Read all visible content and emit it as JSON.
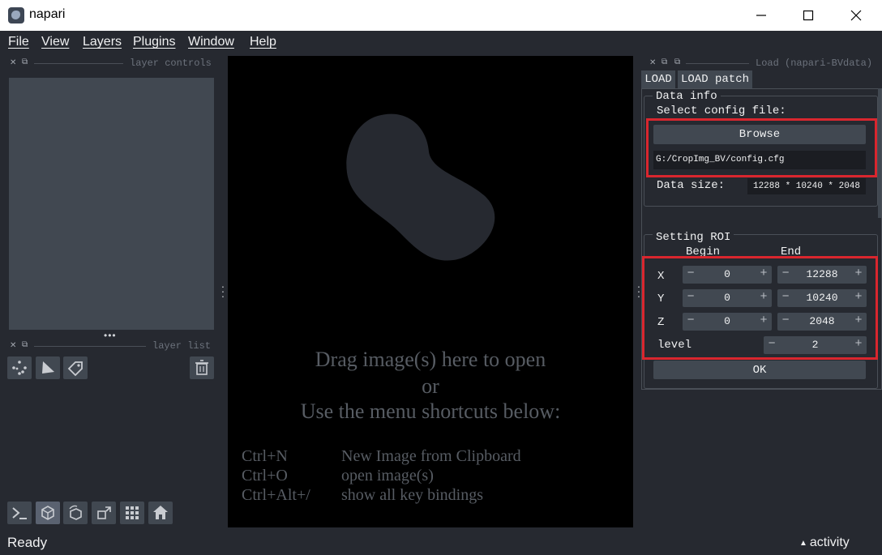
{
  "window": {
    "title": "napari",
    "controls": [
      "minimize-icon",
      "maximize-icon",
      "close-icon"
    ]
  },
  "menu": {
    "items": [
      "File",
      "View",
      "Layers",
      "Plugins",
      "Window",
      "Help"
    ]
  },
  "left_dock": {
    "layer_controls_title": "layer controls",
    "layer_list_title": "layer list",
    "layer_buttons": [
      "new-points-icon",
      "new-shapes-icon",
      "new-labels-icon"
    ],
    "delete_icon": "delete-layer-icon"
  },
  "canvas": {
    "welcome_line1": "Drag image(s) here to open",
    "welcome_or": "or",
    "welcome_line2": "Use the menu shortcuts below:",
    "shortcuts": [
      {
        "key": "Ctrl+N",
        "action": "New Image from Clipboard"
      },
      {
        "key": "Ctrl+O",
        "action": "open image(s)"
      },
      {
        "key": "Ctrl+Alt+/",
        "action": "show all key bindings"
      }
    ]
  },
  "bottom_buttons": [
    "console-icon",
    "ndisplay-icon",
    "roll-dims-icon",
    "transpose-icon",
    "grid-icon",
    "home-icon"
  ],
  "plugin": {
    "dock_title": "Load (napari-BVdata)",
    "tabs": [
      "LOAD",
      "LOAD patch"
    ],
    "data_info": {
      "group_title": "Data info",
      "select_label": "Select config file:",
      "browse_label": "Browse",
      "path_value": "G:/CropImg_BV/config.cfg",
      "size_label": "Data size:",
      "size_value": "12288 * 10240 * 2048"
    },
    "roi": {
      "group_title": "Setting ROI",
      "begin_header": "Begin",
      "end_header": "End",
      "rows": [
        {
          "axis": "X",
          "begin": "0",
          "end": "12288"
        },
        {
          "axis": "Y",
          "begin": "0",
          "end": "10240"
        },
        {
          "axis": "Z",
          "begin": "0",
          "end": "2048"
        }
      ],
      "level_label": "level",
      "level_value": "2",
      "ok_label": "OK"
    }
  },
  "status": {
    "left": "Ready",
    "activity": "activity"
  },
  "colors": {
    "background": "#262930",
    "panel": "#414851",
    "canvas": "#000000",
    "highlight": "#d9262e"
  }
}
